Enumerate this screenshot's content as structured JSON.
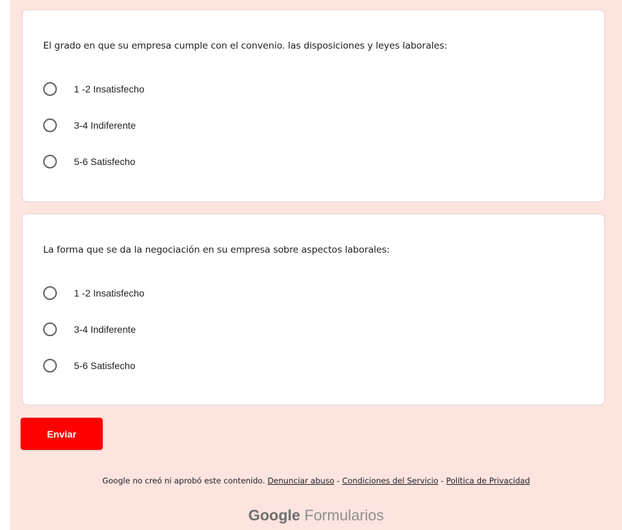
{
  "questions": [
    {
      "text": "El grado en que su empresa cumple con el convenio. las disposiciones y leyes laborales:",
      "options": [
        "1 -2 Insatisfecho",
        "3-4 Indiferente",
        "5-6 Satisfecho"
      ]
    },
    {
      "text": "La forma que se da la negociación en su empresa sobre aspectos laborales:",
      "options": [
        "1 -2 Insatisfecho",
        "3-4 Indiferente",
        "5-6 Satisfecho"
      ]
    }
  ],
  "submit_label": "Enviar",
  "footer": {
    "disclaimer": "Google no creó ni aprobó este contenido.",
    "report_abuse": "Denunciar abuso",
    "separator": " - ",
    "terms": "Condiciones del Servicio",
    "privacy": "Política de Privacidad"
  },
  "brand": {
    "google": "Google",
    "forms": "Formularios"
  },
  "colors": {
    "background": "#fce4df",
    "accent": "#ff0000"
  }
}
